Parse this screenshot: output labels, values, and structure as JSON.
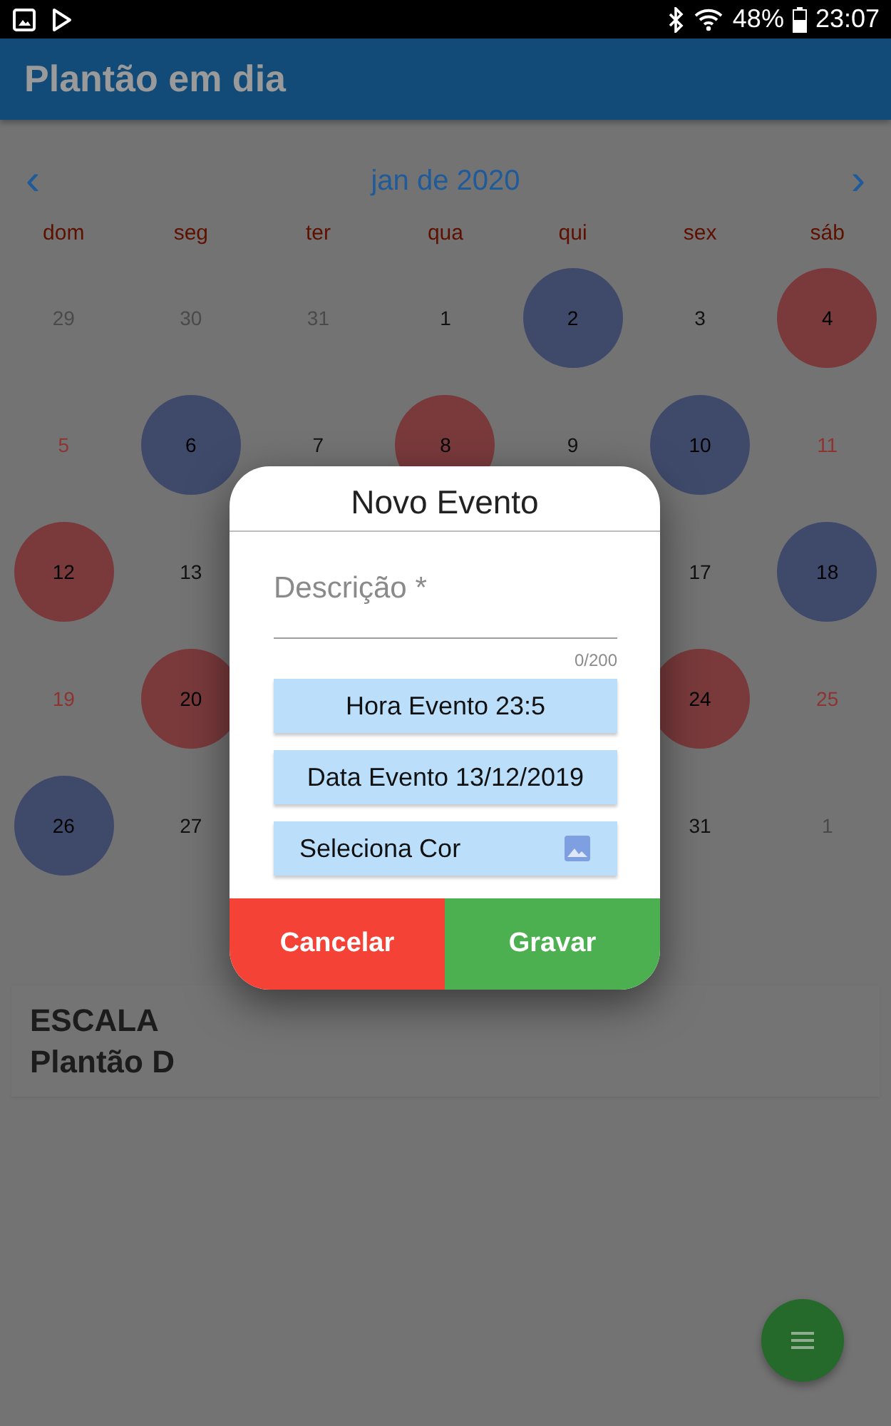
{
  "status_bar": {
    "battery": "48%",
    "time": "23:07"
  },
  "app_bar": {
    "title": "Plantão em dia"
  },
  "calendar": {
    "month": "jan de 2020",
    "prev": "‹",
    "next": "›",
    "weekdays": [
      "dom",
      "seg",
      "ter",
      "qua",
      "qui",
      "sex",
      "sáb"
    ],
    "weeks": [
      {
        "days": [
          {
            "label": "29",
            "kind": "outside"
          },
          {
            "label": "30",
            "kind": "outside"
          },
          {
            "label": "31",
            "kind": "outside"
          },
          {
            "label": "1",
            "kind": "normal"
          },
          {
            "label": "2",
            "kind": "normal",
            "color": "#3f4a6b"
          },
          {
            "label": "3",
            "kind": "normal"
          },
          {
            "label": "4",
            "kind": "weekend",
            "color": "#7a3a3c"
          }
        ]
      },
      {
        "days": [
          {
            "label": "5",
            "kind": "weekend"
          },
          {
            "label": "6",
            "kind": "normal",
            "color": "#3f4a6b"
          },
          {
            "label": "7",
            "kind": "normal"
          },
          {
            "label": "8",
            "kind": "normal",
            "color": "#7a3a3c"
          },
          {
            "label": "9",
            "kind": "normal"
          },
          {
            "label": "10",
            "kind": "normal",
            "color": "#3f4a6b"
          },
          {
            "label": "11",
            "kind": "weekend"
          }
        ]
      },
      {
        "days": [
          {
            "label": "12",
            "kind": "weekend",
            "color": "#7a3a3c"
          },
          {
            "label": "13",
            "kind": "normal"
          }
        ],
        "end_days": [
          {
            "label": "17",
            "kind": "normal"
          },
          {
            "label": "18",
            "kind": "weekend",
            "color": "#3f4a6b"
          }
        ]
      },
      {
        "days": [
          {
            "label": "19",
            "kind": "weekend"
          },
          {
            "label": "20",
            "kind": "normal",
            "color": "#7a3a3c"
          }
        ],
        "end_days": [
          {
            "label": "24",
            "kind": "normal",
            "color": "#7a3a3c"
          },
          {
            "label": "25",
            "kind": "weekend"
          }
        ]
      },
      {
        "days": [
          {
            "label": "26",
            "kind": "weekend",
            "color": "#3f4a6b"
          },
          {
            "label": "27",
            "kind": "normal"
          }
        ],
        "end_days": [
          {
            "label": "31",
            "kind": "normal"
          },
          {
            "label": "1",
            "kind": "outside"
          }
        ]
      }
    ]
  },
  "schedule": {
    "lines": [
      "ESCALA",
      "Plantão D"
    ]
  },
  "dialog": {
    "title": "Novo Evento",
    "description": {
      "placeholder": "Descrição *",
      "counter": "0/200"
    },
    "buttons": [
      {
        "label": "Hora Evento 23:5",
        "kind": "centered"
      },
      {
        "label": "Data Evento 13/12/2019",
        "kind": "centered"
      },
      {
        "label": "Seleciona Cor",
        "kind": "with_icon"
      }
    ],
    "actions": [
      {
        "label": "Cancelar",
        "kind": "cancel"
      },
      {
        "label": "Gravar",
        "kind": "confirm"
      }
    ]
  }
}
